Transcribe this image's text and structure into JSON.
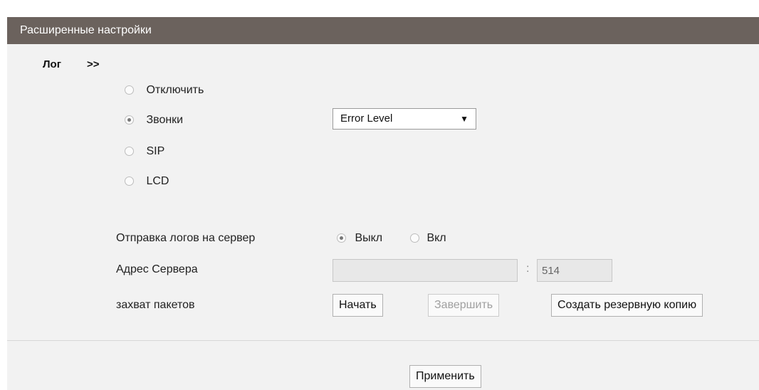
{
  "header": {
    "title": "Расширенные настройки"
  },
  "section": {
    "title": "Лог",
    "arrow": ">>"
  },
  "log_options": [
    {
      "label": "Отключить",
      "checked": false
    },
    {
      "label": "Звонки",
      "checked": true
    },
    {
      "label": "SIP",
      "checked": false
    },
    {
      "label": "LCD",
      "checked": false
    }
  ],
  "level_select": {
    "value": "Error Level"
  },
  "server_log": {
    "label": "Отправка логов на сервер",
    "off_label": "Выкл",
    "on_label": "Вкл",
    "selected": "off"
  },
  "server_address": {
    "label": "Адрес Сервера",
    "address_value": "",
    "separator": ":",
    "port_value": "514"
  },
  "packet_capture": {
    "label": "захват пакетов",
    "start_label": "Начать",
    "stop_label": "Завершить",
    "backup_label": "Создать резервную копию"
  },
  "apply_label": "Применить"
}
